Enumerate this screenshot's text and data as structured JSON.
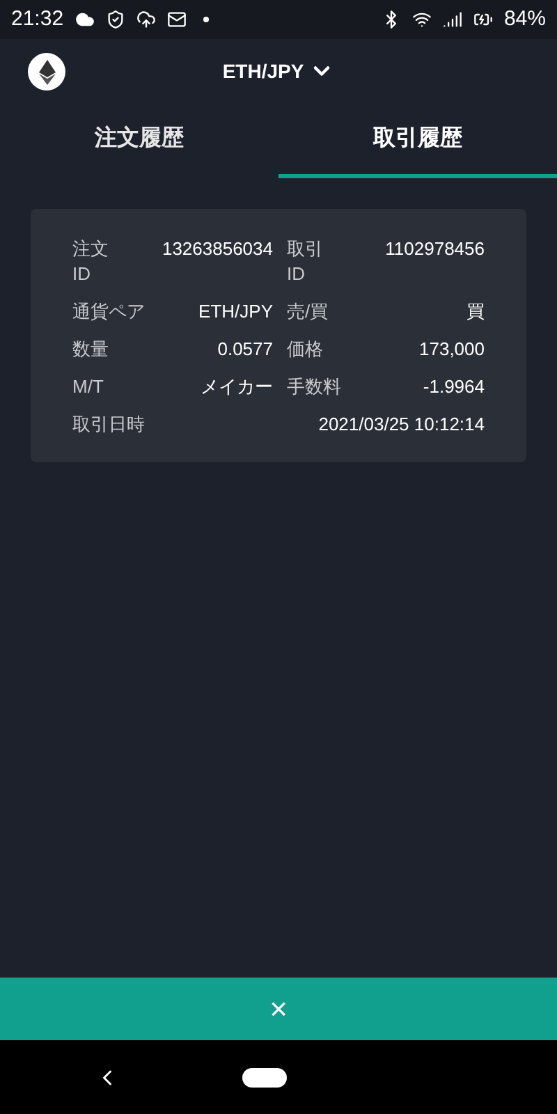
{
  "status_bar": {
    "time": "21:32",
    "battery": "84%"
  },
  "header": {
    "pair": "ETH/JPY"
  },
  "tabs": [
    {
      "label": "注文履歴",
      "selected": false
    },
    {
      "label": "取引履歴",
      "selected": true
    }
  ],
  "details": [
    {
      "label": "注文 ID",
      "value": "13263856034",
      "kind": "pair"
    },
    {
      "label": "取引 ID",
      "value": "1102978456",
      "kind": "pair"
    },
    {
      "label": "通貨ペア",
      "value": "ETH/JPY",
      "kind": "pair"
    },
    {
      "label": "売/買",
      "value": "買",
      "kind": "pair"
    },
    {
      "label": "数量",
      "value": "0.0577",
      "kind": "pair"
    },
    {
      "label": "価格",
      "value": "173,000",
      "kind": "pair"
    },
    {
      "label": "M/T",
      "value": "メイカー",
      "kind": "pair"
    },
    {
      "label": "手数料",
      "value": "-1.9964",
      "kind": "pair"
    },
    {
      "label": "取引日時",
      "value": "2021/03/25 10:12:14",
      "kind": "wide"
    }
  ],
  "close_bar": {
    "label": "×"
  }
}
